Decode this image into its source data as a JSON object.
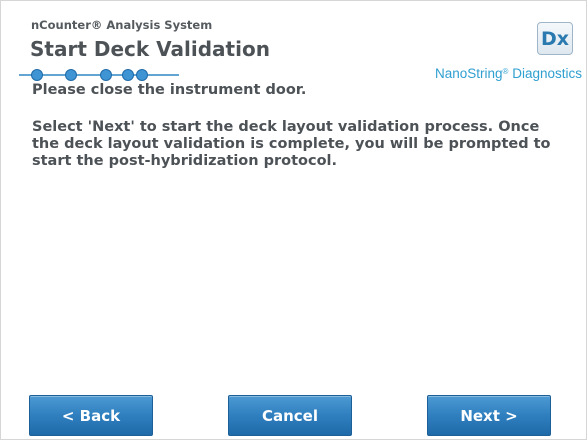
{
  "header": {
    "system_name": "nCounter® Analysis System",
    "title": "Start Deck Validation",
    "badge": "Dx",
    "brand": "NanoString",
    "brand_mark": "®",
    "brand_suffix": " Diagnostics"
  },
  "progress": {
    "total_steps": 5,
    "current_step": 5
  },
  "body": {
    "line1": "Please close the instrument door.",
    "line2": "Select 'Next' to start the deck layout validation process. Once the deck layout validation is complete, you will be prompted to start the post-hybridization protocol."
  },
  "footer": {
    "back_label": "<  Back",
    "cancel_label": "Cancel",
    "next_label": "Next  >"
  },
  "colors": {
    "accent": "#2f9fd0",
    "button": "#2f7fbf",
    "text": "#4d5257"
  }
}
